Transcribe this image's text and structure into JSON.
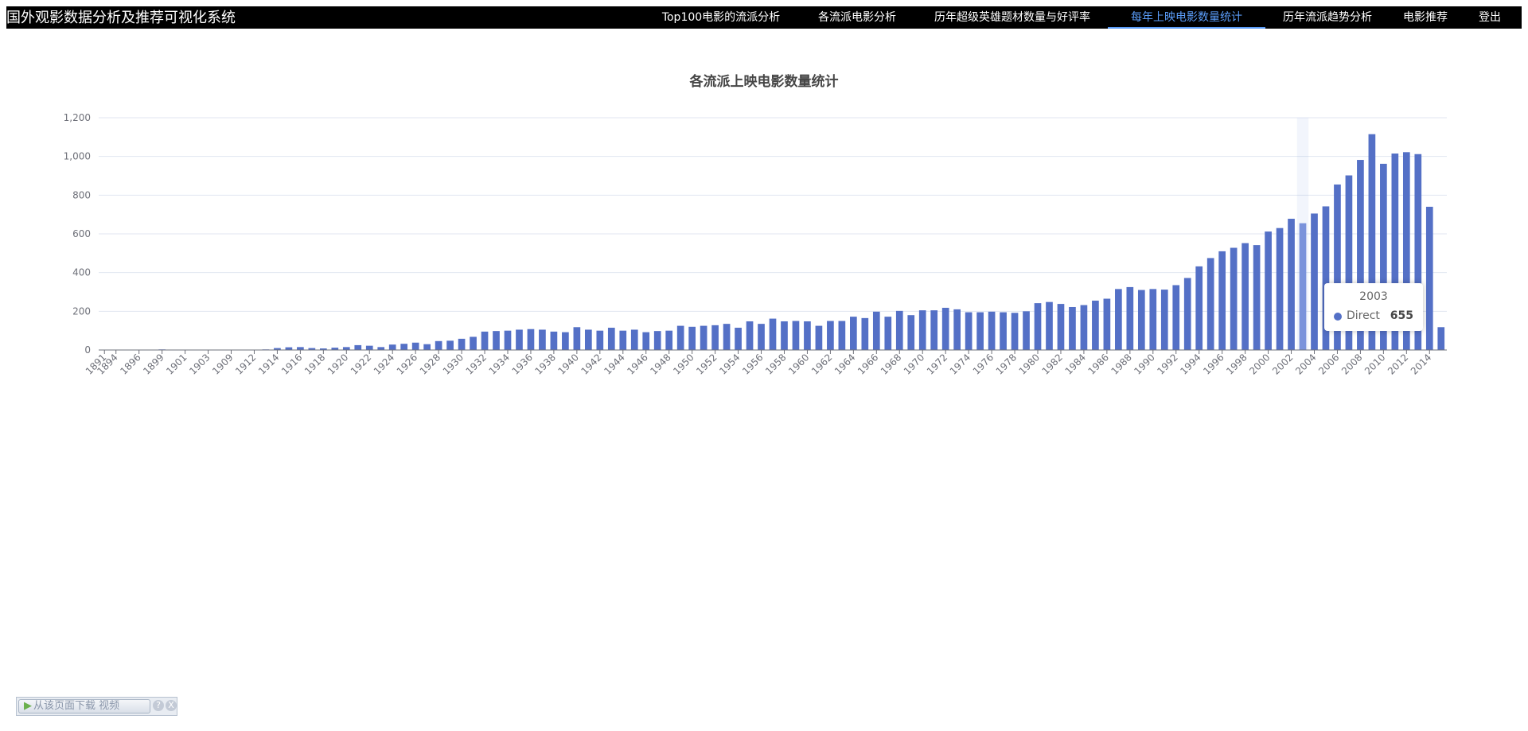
{
  "header": {
    "brand": "国外观影数据分析及推荐可视化系统",
    "nav": [
      {
        "label": "Top100电影的流派分析",
        "active": false
      },
      {
        "label": "各流派电影分析",
        "active": false
      },
      {
        "label": "历年超级英雄题材数量与好评率",
        "active": false
      },
      {
        "label": "每年上映电影数量统计",
        "active": true
      },
      {
        "label": "历年流派趋势分析",
        "active": false
      },
      {
        "label": "电影推荐",
        "active": false
      },
      {
        "label": "登出",
        "active": false
      }
    ]
  },
  "colors": {
    "bar": "#5470c6",
    "bar_highlight": "#7b93db",
    "active_nav": "#5a9cf8"
  },
  "chart_data": {
    "type": "bar",
    "title": "各流派上映电影数量统计",
    "xlabel": "",
    "ylabel": "",
    "ylim": [
      0,
      1200
    ],
    "yticks": [
      0,
      200,
      400,
      600,
      800,
      1000,
      1200
    ],
    "grid": true,
    "categories": [
      "1891",
      "1894",
      "1895",
      "1896",
      "1898",
      "1899",
      "1900",
      "1901",
      "1902",
      "1903",
      "1905",
      "1909",
      "1910",
      "1912",
      "1913",
      "1914",
      "1915",
      "1916",
      "1917",
      "1918",
      "1919",
      "1920",
      "1921",
      "1922",
      "1923",
      "1924",
      "1925",
      "1926",
      "1927",
      "1928",
      "1929",
      "1930",
      "1931",
      "1932",
      "1933",
      "1934",
      "1935",
      "1936",
      "1937",
      "1938",
      "1939",
      "1940",
      "1941",
      "1942",
      "1943",
      "1944",
      "1945",
      "1946",
      "1947",
      "1948",
      "1949",
      "1950",
      "1951",
      "1952",
      "1953",
      "1954",
      "1955",
      "1956",
      "1957",
      "1958",
      "1959",
      "1960",
      "1961",
      "1962",
      "1963",
      "1964",
      "1965",
      "1966",
      "1967",
      "1968",
      "1969",
      "1970",
      "1971",
      "1972",
      "1973",
      "1974",
      "1975",
      "1976",
      "1977",
      "1978",
      "1979",
      "1980",
      "1981",
      "1982",
      "1983",
      "1984",
      "1985",
      "1986",
      "1987",
      "1988",
      "1989",
      "1990",
      "1991",
      "1992",
      "1993",
      "1994",
      "1995",
      "1996",
      "1997",
      "1998",
      "1999",
      "2000",
      "2001",
      "2002",
      "2003",
      "2004",
      "2005",
      "2006",
      "2007",
      "2008",
      "2009",
      "2010",
      "2011",
      "2012",
      "2013",
      "2014",
      "2015"
    ],
    "series": [
      {
        "name": "Direct",
        "values": [
          1,
          1,
          1,
          1,
          1,
          3,
          1,
          1,
          1,
          1,
          1,
          1,
          1,
          2,
          3,
          10,
          14,
          15,
          10,
          8,
          12,
          15,
          25,
          22,
          15,
          28,
          32,
          38,
          30,
          46,
          48,
          58,
          68,
          95,
          98,
          100,
          105,
          108,
          105,
          95,
          92,
          118,
          105,
          100,
          115,
          100,
          105,
          92,
          98,
          100,
          125,
          120,
          125,
          128,
          135,
          115,
          148,
          135,
          162,
          148,
          150,
          148,
          125,
          150,
          150,
          172,
          165,
          198,
          172,
          202,
          180,
          205,
          205,
          218,
          210,
          195,
          195,
          198,
          195,
          192,
          200,
          242,
          248,
          238,
          222,
          232,
          255,
          265,
          315,
          325,
          310,
          315,
          312,
          335,
          372,
          432,
          475,
          510,
          528,
          552,
          542,
          612,
          630,
          678,
          655,
          705,
          742,
          855,
          902,
          982,
          1115,
          962,
          1015,
          1022,
          1012,
          740,
          118
        ]
      }
    ],
    "highlight": {
      "category": "2003",
      "series": "Direct",
      "value": 655
    },
    "visible_x_tick_labels": [
      "1891",
      "1894",
      "1896",
      "1899",
      "1901",
      "1903",
      "1909",
      "1912",
      "1914",
      "1916",
      "1918",
      "1920",
      "1922",
      "1924",
      "1926",
      "1928",
      "1930",
      "1932",
      "1934",
      "1936",
      "1938",
      "1940",
      "1942",
      "1944",
      "1946",
      "1948",
      "1950",
      "1952",
      "1954",
      "1956",
      "1958",
      "1960",
      "1962",
      "1964",
      "1966",
      "1968",
      "1970",
      "1972",
      "1974",
      "1976",
      "1978",
      "1980",
      "1982",
      "1984",
      "1986",
      "1988",
      "1990",
      "1992",
      "1994",
      "1996",
      "1998",
      "2000",
      "2002",
      "2004",
      "2006",
      "2008",
      "2010",
      "2012",
      "2014"
    ],
    "y_tick_labels": [
      "0",
      "200",
      "400",
      "600",
      "800",
      "1,000",
      "1,200"
    ]
  },
  "tooltip": {
    "title": "2003",
    "series_name": "Direct",
    "value": "655"
  },
  "download_bar": {
    "label": "从该页面下载 视频",
    "help": "?",
    "close": "X"
  }
}
